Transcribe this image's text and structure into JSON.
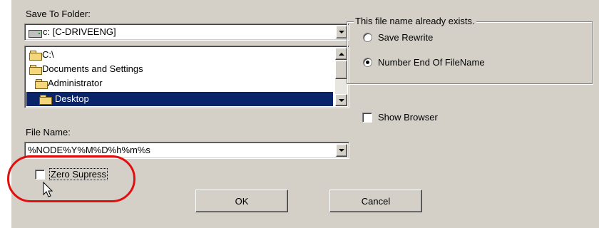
{
  "save_to_folder": {
    "label": "Save To Folder:",
    "drive_value": "c: [C-DRIVEENG]",
    "tree": [
      {
        "label": "C:\\",
        "selected": false
      },
      {
        "label": "Documents and Settings",
        "selected": false
      },
      {
        "label": "Administrator",
        "selected": false
      },
      {
        "label": "Desktop",
        "selected": true
      }
    ]
  },
  "file_name": {
    "label": "File Name:",
    "value": "%NODE%Y%M%D%h%m%s"
  },
  "zero_suppress": {
    "label": "Zero Supress",
    "checked": false
  },
  "exists_group": {
    "title": "This file name already exists.",
    "options": [
      {
        "label": "Save Rewrite",
        "checked": false
      },
      {
        "label": "Number End Of FileName",
        "checked": true
      }
    ]
  },
  "show_browser": {
    "label": "Show Browser",
    "checked": false
  },
  "buttons": {
    "ok": "OK",
    "cancel": "Cancel"
  },
  "colors": {
    "dialog_bg": "#d4d0c8",
    "selection": "#0a246a",
    "highlight_ring": "#e01010"
  },
  "icons": [
    "drive-icon",
    "folder-icon",
    "folder-open-icon",
    "chevron-down-icon",
    "scroll-up-icon",
    "scroll-down-icon",
    "mouse-cursor-icon"
  ]
}
